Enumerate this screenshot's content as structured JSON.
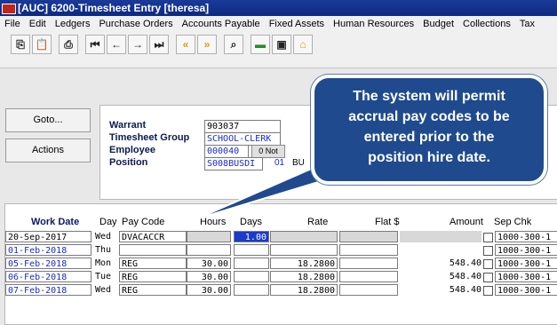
{
  "window": {
    "title": "[AUC] 6200-Timesheet Entry [theresa]"
  },
  "menu": [
    "File",
    "Edit",
    "Ledgers",
    "Purchase Orders",
    "Accounts Payable",
    "Fixed Assets",
    "Human Resources",
    "Budget",
    "Collections",
    "Tax"
  ],
  "toolbar": [
    "copy-icon",
    "paste-icon",
    "print-icon",
    "first-record-icon",
    "previous-record-icon",
    "next-record-icon",
    "last-record-icon",
    "yellow-left-arrows-icon",
    "yellow-right-arrows-icon",
    "search-icon",
    "report-icon",
    "properties-icon",
    "home-icon"
  ],
  "side_buttons": {
    "goto": "Goto...",
    "actions": "Actions"
  },
  "header": {
    "warrant_label": "Warrant",
    "warrant_value": "903037",
    "group_label": "Timesheet Group",
    "group_value": "SCHOOL-CLERK",
    "employee_label": "Employee",
    "employee_value": "000040",
    "notes_button": "0 Not",
    "position_label": "Position",
    "position_value": "S008BUSDI",
    "position_extra1": "01",
    "position_extra2": "BU"
  },
  "grid": {
    "headers": {
      "work_date": "Work Date",
      "day": "Day",
      "pay_code": "Pay Code",
      "hours": "Hours",
      "days": "Days",
      "rate": "Rate",
      "flat": "Flat $",
      "amount": "Amount",
      "sep_chk": "Sep Chk"
    },
    "rows": [
      {
        "date": "20-Sep-2017",
        "day": "Wed",
        "code": "DVACACCR",
        "hours": "",
        "days": "1.00",
        "rate": "",
        "flat": "",
        "amount": "",
        "acct": "1000-300-1"
      },
      {
        "date": "01-Feb-2018",
        "day": "Thu",
        "code": "",
        "hours": "",
        "days": "",
        "rate": "",
        "flat": "",
        "amount": "",
        "acct": "1000-300-1"
      },
      {
        "date": "05-Feb-2018",
        "day": "Mon",
        "code": "REG",
        "hours": "30.00",
        "days": "",
        "rate": "18.2800",
        "flat": "",
        "amount": "548.40",
        "acct": "1000-300-1"
      },
      {
        "date": "06-Feb-2018",
        "day": "Tue",
        "code": "REG",
        "hours": "30.00",
        "days": "",
        "rate": "18.2800",
        "flat": "",
        "amount": "548.40",
        "acct": "1000-300-1"
      },
      {
        "date": "07-Feb-2018",
        "day": "Wed",
        "code": "REG",
        "hours": "30.00",
        "days": "",
        "rate": "18.2800",
        "flat": "",
        "amount": "548.40",
        "acct": "1000-300-1"
      }
    ]
  },
  "callout": {
    "line1": "The system will permit",
    "line2": "accrual pay codes to be",
    "line3": "entered prior to the",
    "line4": "position hire date."
  },
  "colors": {
    "title_bar": "#0d2a80",
    "callout": "#1f4a8e",
    "field_blue": "#1a2ad0",
    "selected": "#1a3ad0"
  }
}
